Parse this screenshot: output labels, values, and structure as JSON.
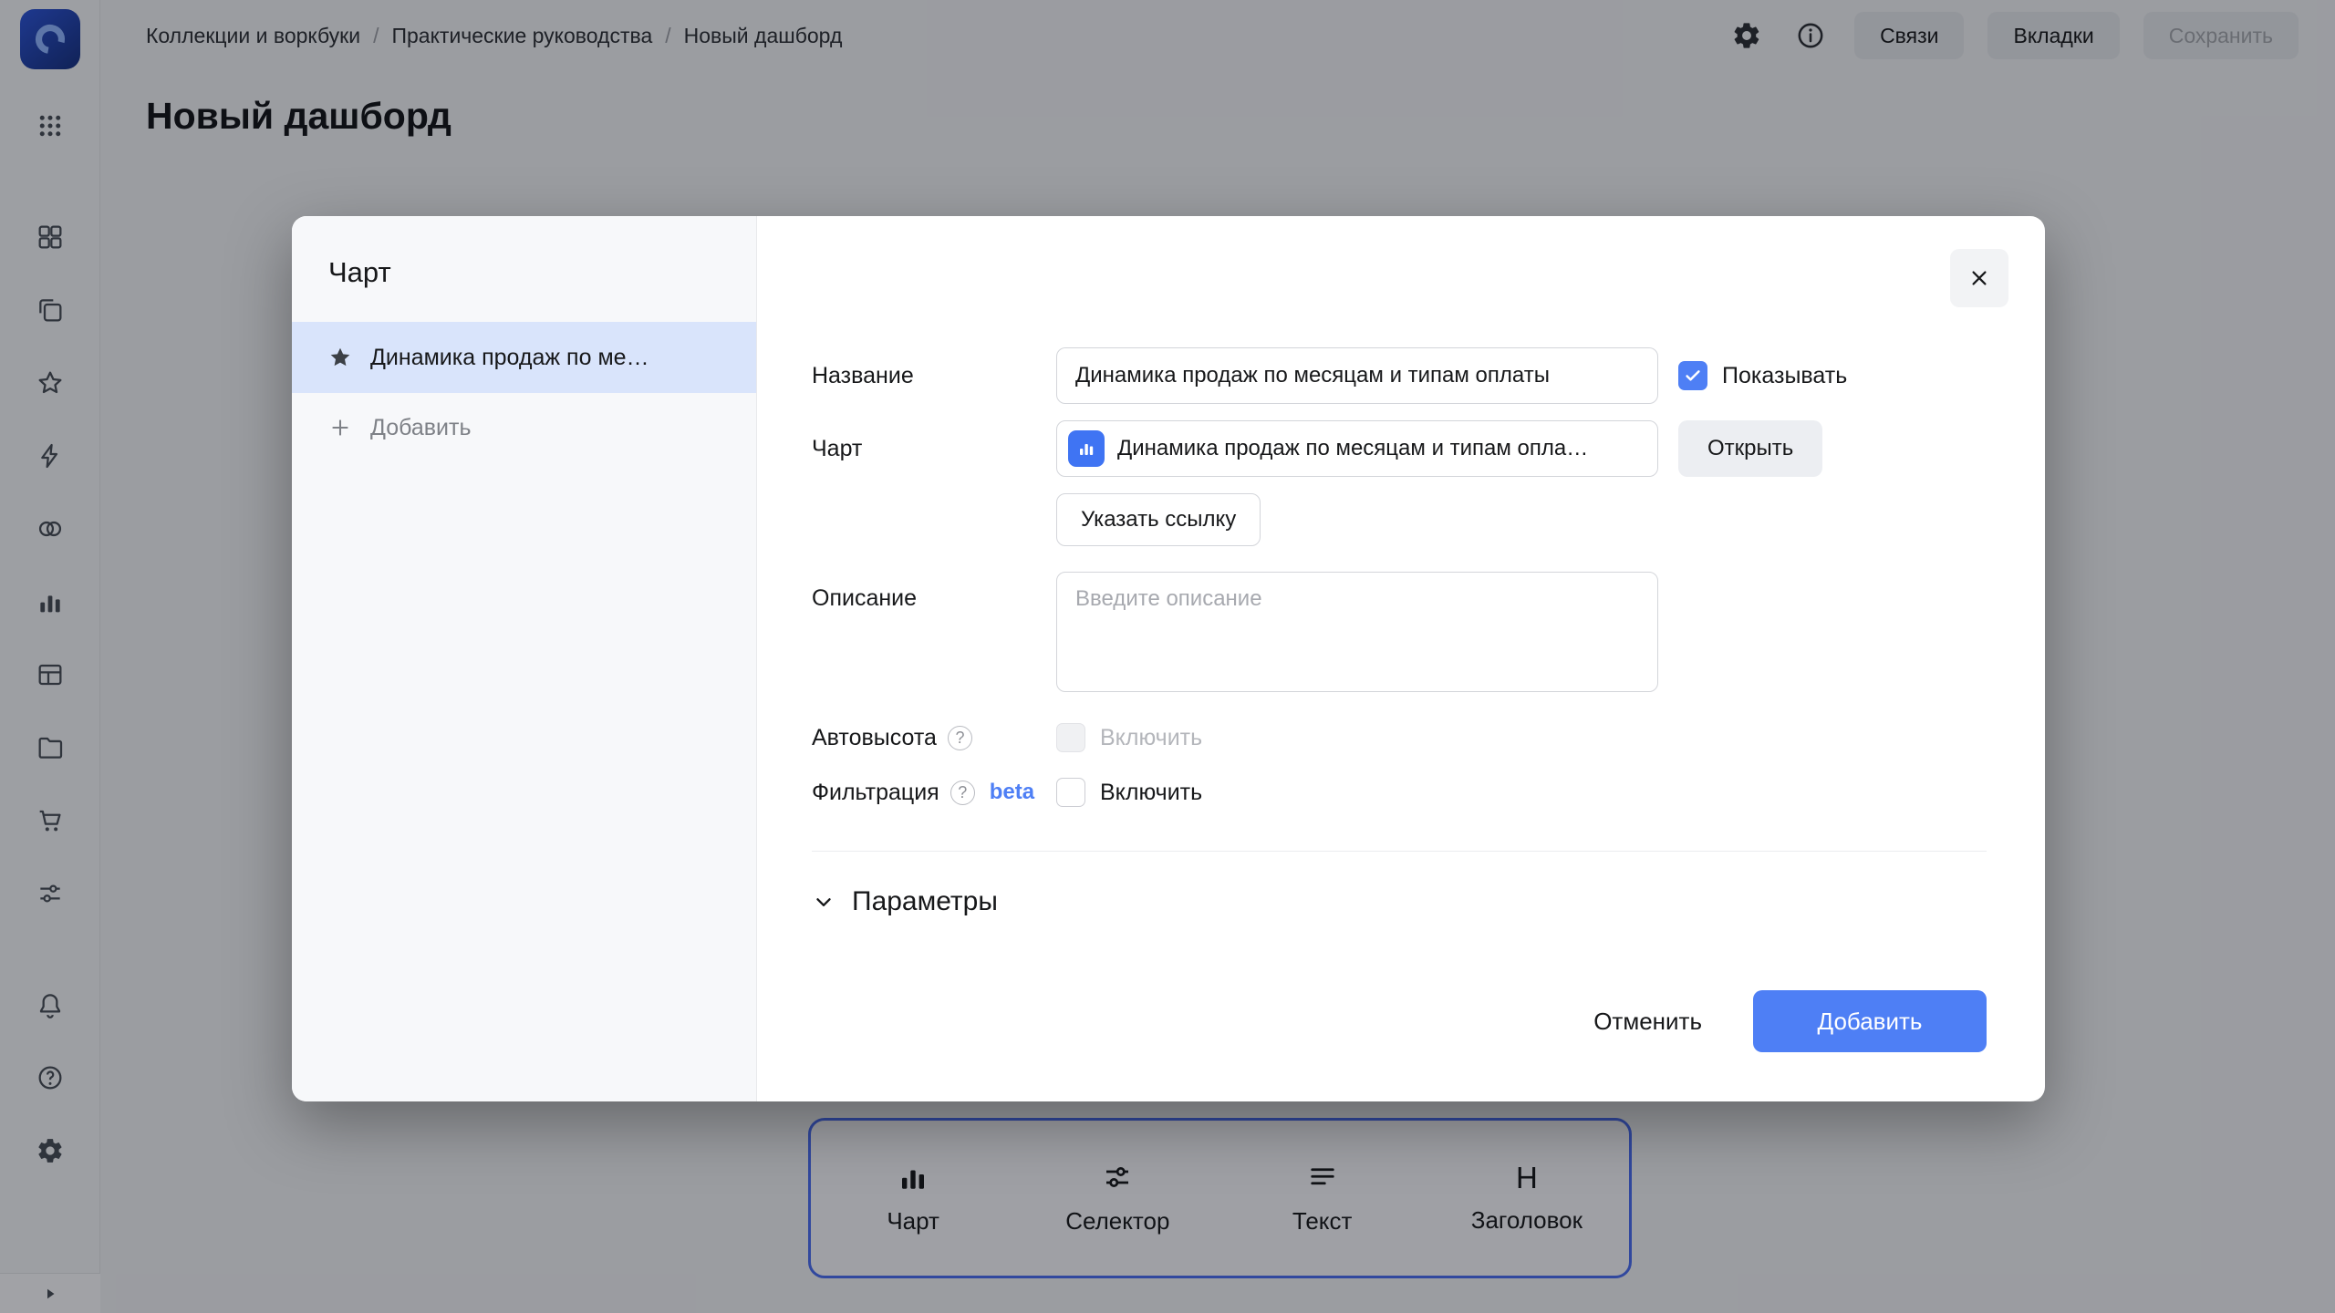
{
  "colors": {
    "accent": "#4e7ff5",
    "toolbar_border": "#4a6cf0",
    "selected_item_bg": "#d9e4fb"
  },
  "header": {
    "breadcrumbs": [
      "Коллекции и воркбуки",
      "Практические руководства",
      "Новый дашборд"
    ],
    "separator": "/",
    "buttons": {
      "relations": "Связи",
      "tabs": "Вкладки",
      "save": "Сохранить"
    }
  },
  "page": {
    "title": "Новый дашборд"
  },
  "modal": {
    "panel": {
      "title": "Чарт",
      "selected_item": "Динамика продаж по ме…",
      "add": "Добавить"
    },
    "form": {
      "name": {
        "label": "Название",
        "value": "Динамика продаж по месяцам и типам оплаты",
        "show": "Показывать"
      },
      "chart": {
        "label": "Чарт",
        "value": "Динамика продаж по месяцам и типам опла…",
        "open": "Открыть",
        "link": "Указать ссылку"
      },
      "description": {
        "label": "Описание",
        "placeholder": "Введите описание"
      },
      "autoheight": {
        "label": "Автовысота",
        "toggle": "Включить"
      },
      "filtering": {
        "label": "Фильтрация",
        "beta": "beta",
        "toggle": "Включить"
      },
      "params": {
        "label": "Параметры"
      }
    },
    "footer": {
      "cancel": "Отменить",
      "submit": "Добавить"
    }
  },
  "toolbar": {
    "items": [
      {
        "label": "Чарт"
      },
      {
        "label": "Селектор"
      },
      {
        "label": "Текст"
      },
      {
        "label": "Заголовок",
        "glyph": "H"
      }
    ]
  },
  "icons": {
    "question": "?"
  }
}
